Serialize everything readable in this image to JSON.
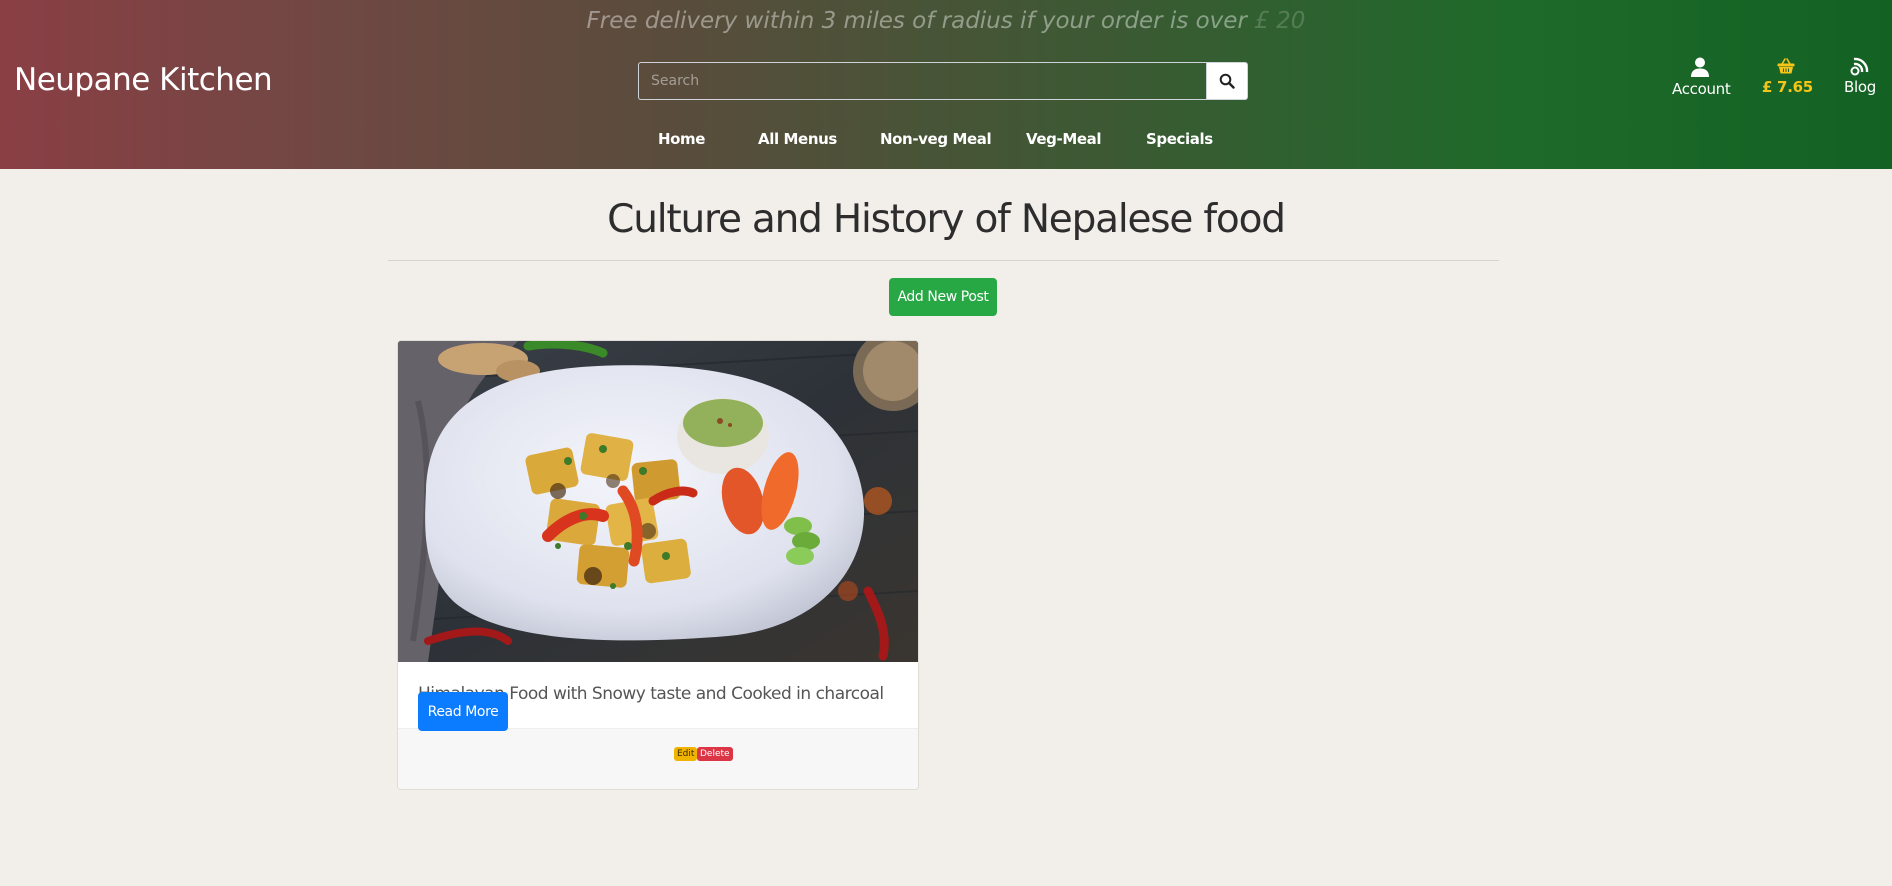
{
  "header": {
    "promo_text": "Free delivery within 3 miles of radius if your order is over",
    "promo_amount": "£ 20",
    "brand": "Neupane Kitchen",
    "search_placeholder": "Search",
    "nav": [
      "Home",
      "All Menus",
      "Non-veg Meal",
      "Veg-Meal",
      "Specials"
    ],
    "account_label": "Account",
    "cart_total": "£ 7.65",
    "blog_label": "Blog",
    "gradient_colors": [
      "#8a3f45",
      "#136224"
    ]
  },
  "main": {
    "title": "Culture and History of Nepalese food",
    "add_post_label": "Add New Post",
    "post": {
      "title": "Himalayan Food with Snowy taste and Cooked in charcoal",
      "read_more_label": "Read More",
      "edit_label": "Edit",
      "delete_label": "Delete"
    }
  },
  "colors": {
    "success": "#28a745",
    "primary": "#0b7bff",
    "warning": "#f0b400",
    "danger": "#dc3545",
    "cart": "#f5c518"
  }
}
